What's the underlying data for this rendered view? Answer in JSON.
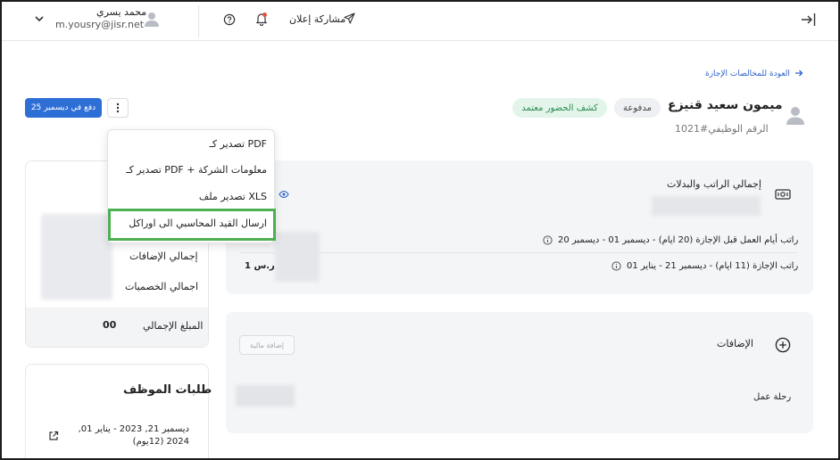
{
  "topbar": {
    "user_name": "محمد يسري",
    "user_email": "m.yousry@jisr.net",
    "share_label": "مشاركة إعلان"
  },
  "back_link": "العودة للمخالصات الإجازة",
  "employee": {
    "name": "ميمون سعيد قنيزع",
    "status_paid": "مدفوعة",
    "status_attendance": "كشف الحضور معتمد",
    "employee_id": "الرقم الوظيفي#1021"
  },
  "pay_button": "دفع في ديسمبر 25",
  "menu": {
    "items": [
      "تصدير كـ PDF",
      "تصدير كـ PDF + معلومات الشركة",
      "تصدير ملف XLS",
      "ارسال القيد المحاسبي الى اوراكل"
    ]
  },
  "salary": {
    "title": "إجمالي الراتب والبدلات",
    "row1_label": "راتب أيام العمل قبل الإجازة (20 ايام) - ديسمبر 01 - ديسمبر 20",
    "row2_label": "راتب الإجازة (11 ايام) - ديسمبر 21 - يناير 01",
    "row1_value": "",
    "row2_value": "1 ر.س"
  },
  "summary": {
    "additions": "إجمالي الإضافات",
    "deductions": "اجمالي الخصميات",
    "total": "المبلغ الإجمالي",
    "total_value": "00"
  },
  "additions": {
    "title": "الإضافات",
    "add_button": "إضافة مالية",
    "trip_label": "رحلة عمل"
  },
  "requests": {
    "title": "طلبات الموظف",
    "item_dates": "ديسمبر 21, 2023 - يناير 01, 2024 (12يوم)"
  }
}
